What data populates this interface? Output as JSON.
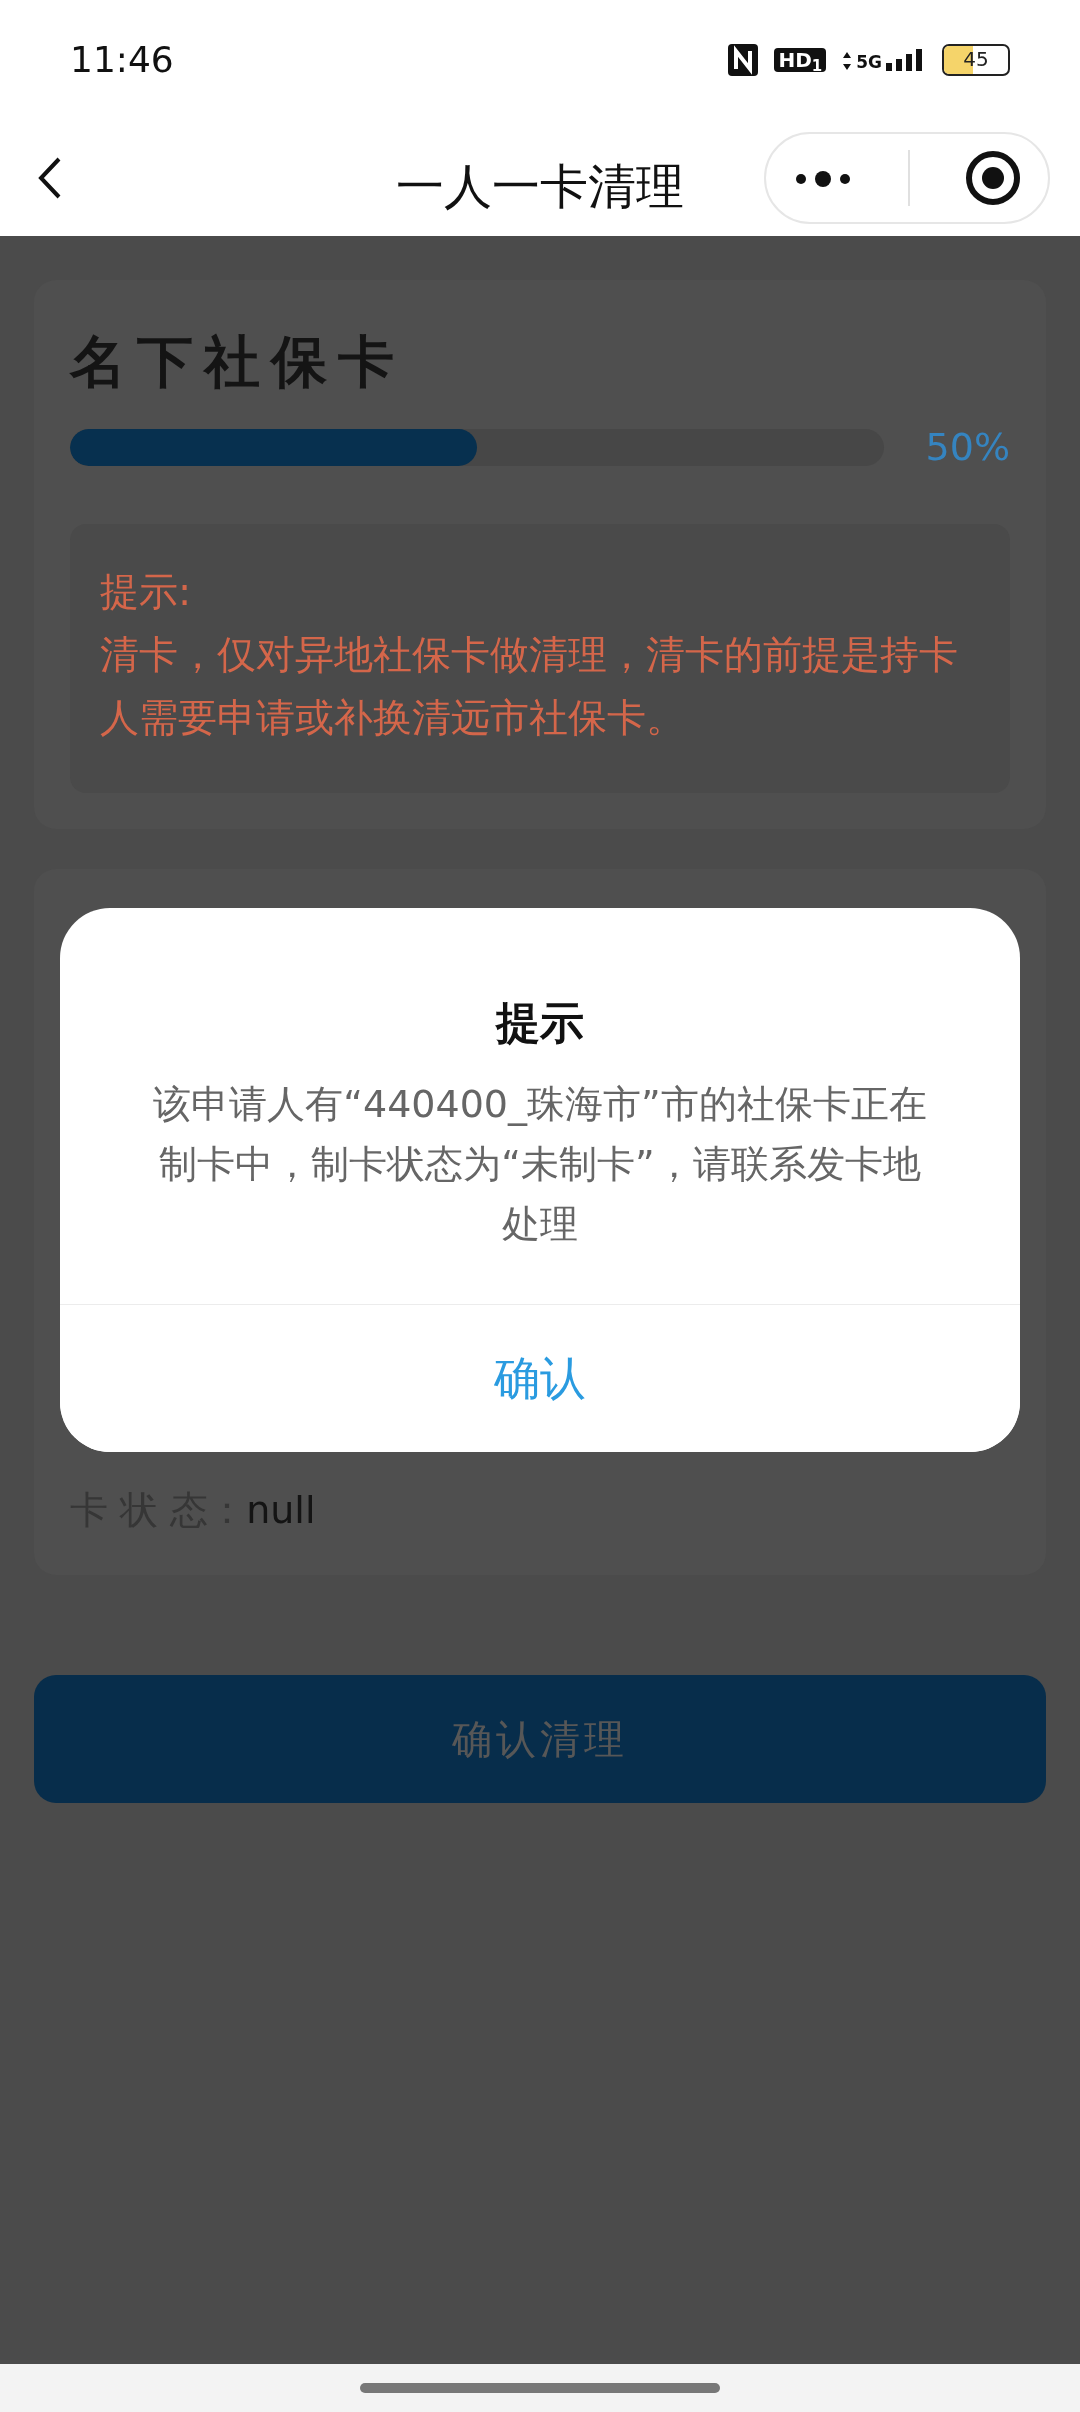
{
  "status_bar": {
    "time": "11:46",
    "hd": "HD$_{1}$",
    "network": "5G",
    "battery": "45"
  },
  "nav": {
    "title": "一人一卡清理"
  },
  "card": {
    "title": "名下社保卡",
    "progress": {
      "level": 0.5,
      "reading": "50%"
    },
    "tip": {
      "label": "提示:",
      "text": "清卡，仅对异地社保卡做清理，清卡的前提是持卡人需要申请或补换清远市社保卡。"
    }
  },
  "details": [
    {
      "label": "卡 状 态：",
      "value": "null"
    }
  ],
  "primary_button": "确认清理",
  "dialog": {
    "title": "提示",
    "message": "该申请人有“440400_珠海市”市的社保卡正在制卡中，制卡状态为“未制卡”，请联系发卡地处理",
    "button": "确认"
  }
}
